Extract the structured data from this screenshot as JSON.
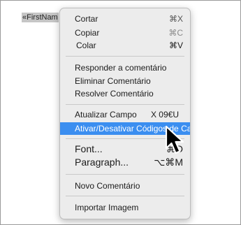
{
  "document": {
    "field_text": "«FirstNam"
  },
  "menu": {
    "groups": [
      {
        "items": [
          {
            "label": "Cortar",
            "shortcut": "⌘X"
          },
          {
            "label": "Copiar",
            "shortcut": "⌘C"
          },
          {
            "label": "Colar",
            "shortcut": "⌘V"
          }
        ]
      },
      {
        "items": [
          {
            "label": "Responder a comentário"
          },
          {
            "label": "Eliminar Comentário"
          },
          {
            "label": "Resolver Comentário"
          }
        ]
      },
      {
        "items": [
          {
            "label": "Atualizar Campo",
            "shortcut": "X 09€U"
          },
          {
            "label": "Ativar/Desativar Códigos de Campo"
          }
        ]
      },
      {
        "items": [
          {
            "label": "Font...",
            "shortcut": "⌘D"
          },
          {
            "label": "Paragraph...",
            "shortcut": "⌥⌘M"
          }
        ]
      },
      {
        "items": [
          {
            "label": "Novo Comentário"
          }
        ]
      },
      {
        "items": [
          {
            "label": "Importar Imagem"
          }
        ]
      }
    ]
  },
  "highlight_color": "#3b8ef0"
}
